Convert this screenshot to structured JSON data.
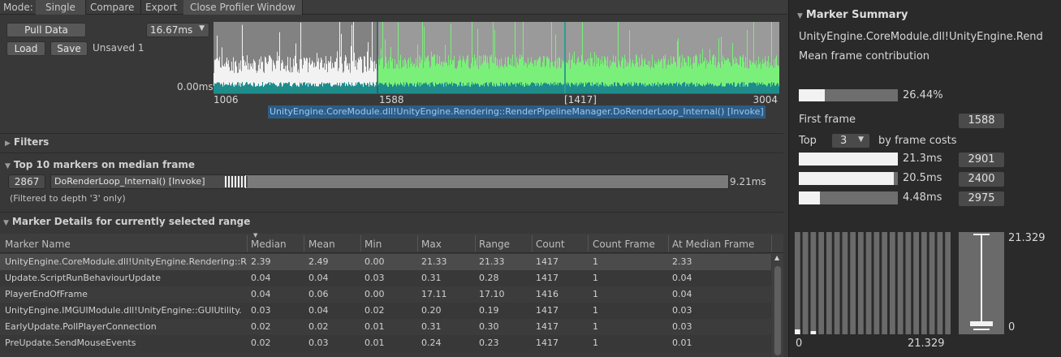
{
  "toolbar": {
    "mode_label": "Mode:",
    "single": "Single",
    "compare": "Compare",
    "export": "Export",
    "close": "Close Profiler Window"
  },
  "controls": {
    "pull_data": "Pull Data",
    "load": "Load",
    "save": "Save",
    "unsaved": "Unsaved 1",
    "time_select": "16.67ms"
  },
  "graph": {
    "y_zero": "0.00ms",
    "x_labels": [
      "1006",
      "1588",
      "[1417]",
      "3004"
    ],
    "selected_marker": "UnityEngine.CoreModule.dll!UnityEngine.Rendering::RenderPipelineManager.DoRenderLoop_Internal() [Invoke]"
  },
  "filters": {
    "title": "Filters"
  },
  "top10": {
    "title": "Top 10 markers on median frame",
    "frame": "2867",
    "marker_label": "DoRenderLoop_Internal() [Invoke]",
    "time": "9.21ms",
    "note": "(Filtered to depth '3' only)"
  },
  "details": {
    "title": "Marker Details for currently selected range",
    "columns": [
      "Marker Name",
      "Median",
      "Mean",
      "Min",
      "Max",
      "Range",
      "Count",
      "Count Frame",
      "At Median Frame"
    ],
    "rows": [
      [
        "UnityEngine.CoreModule.dll!UnityEngine.Rendering::R",
        "2.39",
        "2.49",
        "0.00",
        "21.33",
        "21.33",
        "1417",
        "1",
        "2.33"
      ],
      [
        "Update.ScriptRunBehaviourUpdate",
        "0.04",
        "0.04",
        "0.03",
        "0.31",
        "0.28",
        "1417",
        "1",
        "0.04"
      ],
      [
        "PlayerEndOfFrame",
        "0.04",
        "0.06",
        "0.00",
        "17.11",
        "17.10",
        "1416",
        "1",
        "0.04"
      ],
      [
        "UnityEngine.IMGUIModule.dll!UnityEngine::GUIUtility.",
        "0.03",
        "0.04",
        "0.02",
        "0.20",
        "0.19",
        "1417",
        "1",
        "0.03"
      ],
      [
        "EarlyUpdate.PollPlayerConnection",
        "0.02",
        "0.02",
        "0.01",
        "0.31",
        "0.30",
        "1417",
        "1",
        "0.03"
      ],
      [
        "PreUpdate.SendMouseEvents",
        "0.02",
        "0.03",
        "0.01",
        "0.24",
        "0.23",
        "1417",
        "1",
        "0.01"
      ]
    ]
  },
  "summary": {
    "title": "Marker Summary",
    "marker_name": "UnityEngine.CoreModule.dll!UnityEngine.Rend",
    "contribution_label": "Mean frame contribution",
    "contribution_value": "26.44%",
    "contribution_fraction": 0.2644,
    "first_frame_label": "First frame",
    "first_frame_value": "1588",
    "top_label": "Top",
    "top_count": "3",
    "by_costs": "by frame costs",
    "top_frames": [
      {
        "time": "21.3ms",
        "frame": "2901",
        "fraction": 1.0
      },
      {
        "time": "20.5ms",
        "frame": "2400",
        "fraction": 0.96
      },
      {
        "time": "4.48ms",
        "frame": "2975",
        "fraction": 0.21
      }
    ],
    "hist_min": "0",
    "hist_max": "21.329",
    "box_max": "21.329",
    "box_min": "0"
  }
}
